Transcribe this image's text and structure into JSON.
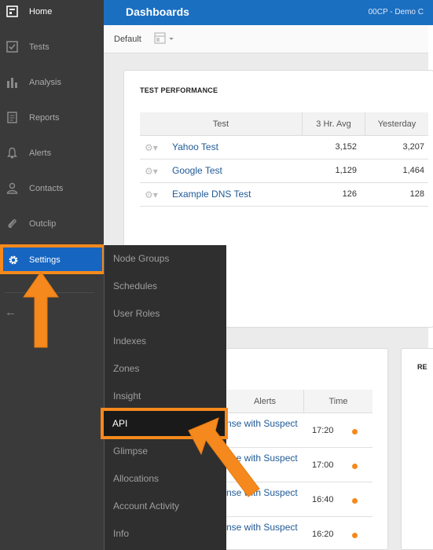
{
  "sidebar": {
    "items": [
      {
        "label": "Home",
        "icon": "home-icon"
      },
      {
        "label": "Tests",
        "icon": "check-square-icon"
      },
      {
        "label": "Analysis",
        "icon": "bar-chart-icon"
      },
      {
        "label": "Reports",
        "icon": "document-icon"
      },
      {
        "label": "Alerts",
        "icon": "bell-icon"
      },
      {
        "label": "Contacts",
        "icon": "person-icon"
      },
      {
        "label": "Outclip",
        "icon": "paperclip-icon"
      },
      {
        "label": "Settings",
        "icon": "gear-icon"
      }
    ]
  },
  "header": {
    "title": "Dashboards",
    "org": "00CP - Demo C"
  },
  "subbar": {
    "dashboard_name": "Default"
  },
  "perf": {
    "title": "TEST PERFORMANCE",
    "columns": [
      "Test",
      "3 Hr. Avg",
      "Yesterday"
    ],
    "rows": [
      {
        "test": "Yahoo Test",
        "avg": "3,152",
        "yesterday": "3,207"
      },
      {
        "test": "Google Test",
        "avg": "1,129",
        "yesterday": "1,464"
      },
      {
        "test": "Example DNS Test",
        "avg": "126",
        "yesterday": "128"
      }
    ]
  },
  "alerts": {
    "columns": [
      "Alerts",
      "Time"
    ],
    "rows": [
      {
        "text": "nse with Suspect",
        "time": "17:20"
      },
      {
        "text": "nse with Suspect",
        "time": "17:00"
      },
      {
        "text": "nse with Suspect",
        "time": "16:40"
      },
      {
        "text": "nse with Suspect",
        "time": "16:20"
      }
    ]
  },
  "right_panel": {
    "title_fragment": "RE"
  },
  "submenu": {
    "items": [
      "Node Groups",
      "Schedules",
      "User Roles",
      "Indexes",
      "Zones",
      "Insight",
      "API",
      "Glimpse",
      "Allocations",
      "Account Activity",
      "Info"
    ]
  },
  "colors": {
    "accent": "#f5891d",
    "brand_blue": "#1b6fc1",
    "sidebar": "#3a3a3a"
  }
}
